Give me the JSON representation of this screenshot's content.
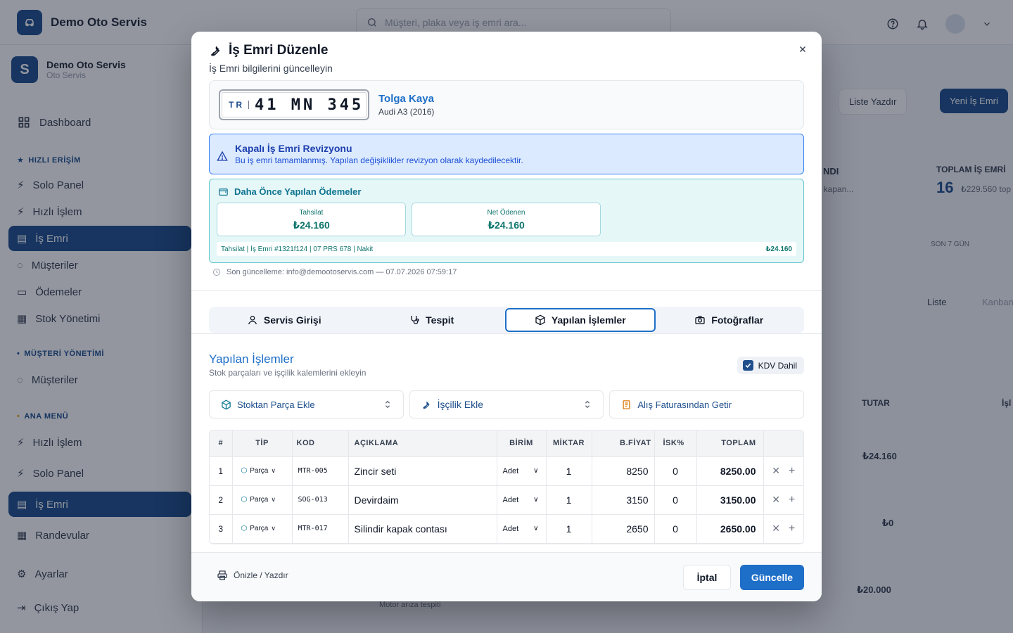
{
  "app": {
    "name": "Demo Oto Servis"
  },
  "search": {
    "placeholder": "Müşteri, plaka veya iş emri ara..."
  },
  "workspace": {
    "name": "Demo Oto Servis",
    "sub": "Oto Servis",
    "initial": "S"
  },
  "sidebar": {
    "dashboard": "Dashboard",
    "quick_access_label": "HIZLI ERİŞİM",
    "quick": [
      "Solo Panel",
      "Hızlı İşlem",
      "İş Emri",
      "Müşteriler",
      "Ödemeler",
      "Stok Yönetimi"
    ],
    "customer_mgmt_label": "MÜŞTERİ YÖNETİMİ",
    "customers": "Müşteriler",
    "main_menu_label": "ANA MENÜ",
    "main": [
      "Hızlı İşlem",
      "Solo Panel",
      "İş Emri",
      "Randevular"
    ],
    "settings": "Ayarlar",
    "logout": "Çıkış Yap"
  },
  "background": {
    "print_list": "Liste Yazdır",
    "new_order": "Yeni İş Emri",
    "stat_partial": "NDI",
    "stat_partial_sub": "la kapan...",
    "total_label": "TOPLAM İŞ EMRİ",
    "total_value": "16",
    "total_sub": "₺229.560 top",
    "last7": "SON 7 GÜN",
    "view_list": "Liste",
    "view_kanban": "Kanban",
    "col_total": "TUTAR",
    "col_action": "İşl",
    "row_amounts": [
      "₺24.160",
      "₺0",
      "₺20.000"
    ],
    "row_note": "Motor arıza tespiti"
  },
  "modal": {
    "title": "İş Emri Düzenle",
    "subtitle": "İş Emri bilgilerini güncelleyin",
    "plate_country": "TR",
    "plate_number": "41 MN 345",
    "customer_name": "Tolga Kaya",
    "vehicle": "Audi A3 (2016)",
    "revision_title": "Kapalı İş Emri Revizyonu",
    "revision_desc": "Bu iş emri tamamlanmış. Yapılan değişiklikler revizyon olarak kaydedilecektir.",
    "payments_title": "Daha Önce Yapılan Ödemeler",
    "collected_label": "Tahsilat",
    "collected_value": "₺24.160",
    "net_label": "Net Ödenen",
    "net_value": "₺24.160",
    "payment_line": "Tahsilat | İş Emri #1321f124 | 07 PRS 678 | Nakit",
    "payment_line_amount": "₺24.160",
    "last_update": "Son güncelleme: info@demootoservis.com — 07.07.2026 07:59:17",
    "tabs": [
      "Servis Girişi",
      "Tespit",
      "Yapılan İşlemler",
      "Fotoğraflar"
    ],
    "active_tab": "Yapılan İşlemler",
    "section_title": "Yapılan İşlemler",
    "section_sub": "Stok parçaları ve işçilik kalemlerini ekleyin",
    "kdv_label": "KDV Dahil",
    "kdv_checked": true,
    "add_stock": "Stoktan Parça Ekle",
    "add_labor": "İşçilik Ekle",
    "add_invoice": "Alış Faturasından Getir",
    "columns": [
      "#",
      "TİP",
      "KOD",
      "AÇIKLAMA",
      "BİRİM",
      "MİKTAR",
      "B.FİYAT",
      "İSK%",
      "TOPLAM"
    ],
    "rows": [
      {
        "idx": "1",
        "type": "Parça",
        "code": "MTR-005",
        "desc": "Zincir seti",
        "unit": "Adet",
        "qty": "1",
        "price": "8250",
        "disc": "0",
        "total": "8250.00"
      },
      {
        "idx": "2",
        "type": "Parça",
        "code": "SOG-013",
        "desc": "Devirdaim",
        "unit": "Adet",
        "qty": "1",
        "price": "3150",
        "disc": "0",
        "total": "3150.00"
      },
      {
        "idx": "3",
        "type": "Parça",
        "code": "MTR-017",
        "desc": "Silindir kapak contası",
        "unit": "Adet",
        "qty": "1",
        "price": "2650",
        "disc": "0",
        "total": "2650.00"
      }
    ],
    "print_label": "Önizle / Yazdır",
    "cancel": "İptal",
    "update": "Güncelle"
  },
  "colors": {
    "primary": "#1e4f8c",
    "accent": "#1e6fc8",
    "teal": "#0e7490"
  }
}
